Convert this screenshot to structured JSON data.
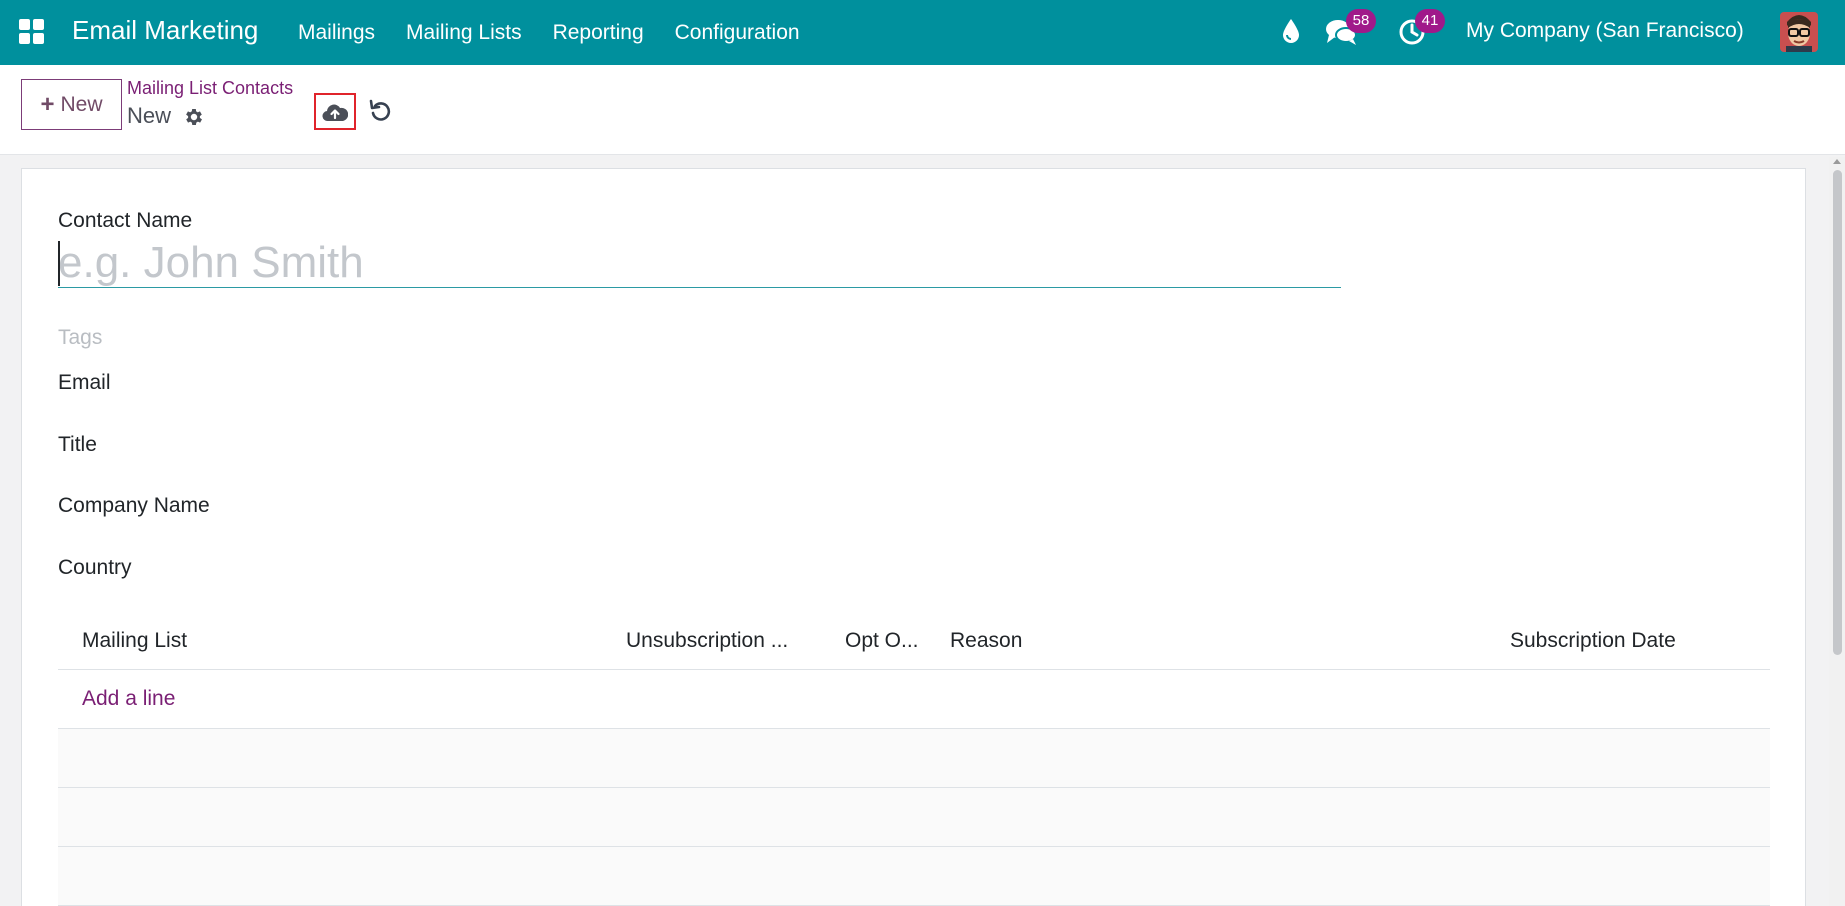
{
  "navbar": {
    "app_name": "Email Marketing",
    "menu": [
      {
        "label": "Mailings"
      },
      {
        "label": "Mailing Lists"
      },
      {
        "label": "Reporting"
      },
      {
        "label": "Configuration"
      }
    ],
    "messages_count": "58",
    "activities_count": "41",
    "company": "My Company (San Francisco)",
    "icons": [
      "apps-grid-icon",
      "water-drop-icon",
      "chat-bubbles-icon",
      "activity-clock-icon",
      "user-avatar"
    ],
    "color": "#00909d",
    "badge_color": "#a0198a"
  },
  "control_panel": {
    "new_button": "New",
    "breadcrumb": "Mailing List Contacts",
    "record_name": "New",
    "icons": [
      "gear-icon",
      "cloud-upload-icon",
      "undo-icon"
    ],
    "save_highlight_color": "#e0242b"
  },
  "form": {
    "contact_name_label": "Contact Name",
    "contact_name_value": "",
    "contact_name_placeholder": "e.g. John Smith",
    "tags_placeholder": "Tags",
    "fields": [
      {
        "label": "Email"
      },
      {
        "label": "Title"
      },
      {
        "label": "Company Name"
      },
      {
        "label": "Country"
      }
    ]
  },
  "subscriptions": {
    "columns": [
      "Mailing List",
      "Unsubscription ...",
      "Opt O...",
      "Reason",
      "Subscription Date"
    ],
    "add_line": "Add a line",
    "rows": []
  }
}
